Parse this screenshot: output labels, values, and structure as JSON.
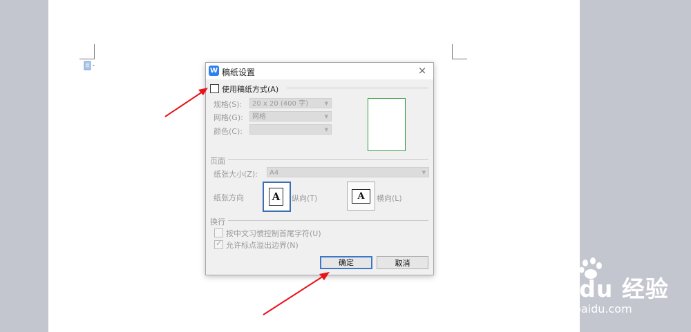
{
  "dialog": {
    "title": "稿纸设置",
    "app_icon": "W",
    "close_icon": "×",
    "use_grid_label": "使用稿纸方式(A)",
    "spec_label": "规格(S):",
    "spec_value": "20 x 20 (400 字)",
    "grid_label": "网格(G):",
    "grid_value": "网格",
    "color_label": "颜色(C):",
    "color_value": "",
    "page_section": "页面",
    "paper_size_label": "纸张大小(Z):",
    "paper_size_value": "A4",
    "orientation_label": "纸张方向",
    "portrait_label": "纵向(T)",
    "landscape_label": "横向(L)",
    "orientation_glyph": "A",
    "wrap_section": "换行",
    "option1_label": "按中文习惯控制首尾字符(U)",
    "option2_label": "允许标点溢出边界(N)",
    "ok_label": "确定",
    "cancel_label": "取消"
  },
  "watermark": {
    "brand": "Bai du 经验",
    "url": "jingyan.baidu.com"
  },
  "colors": {
    "annotation_arrow": "#e8141a",
    "preview_border": "#2a9a3a",
    "primary_focus": "#3c78c8",
    "app_icon_bg": "#2e7ff0"
  }
}
